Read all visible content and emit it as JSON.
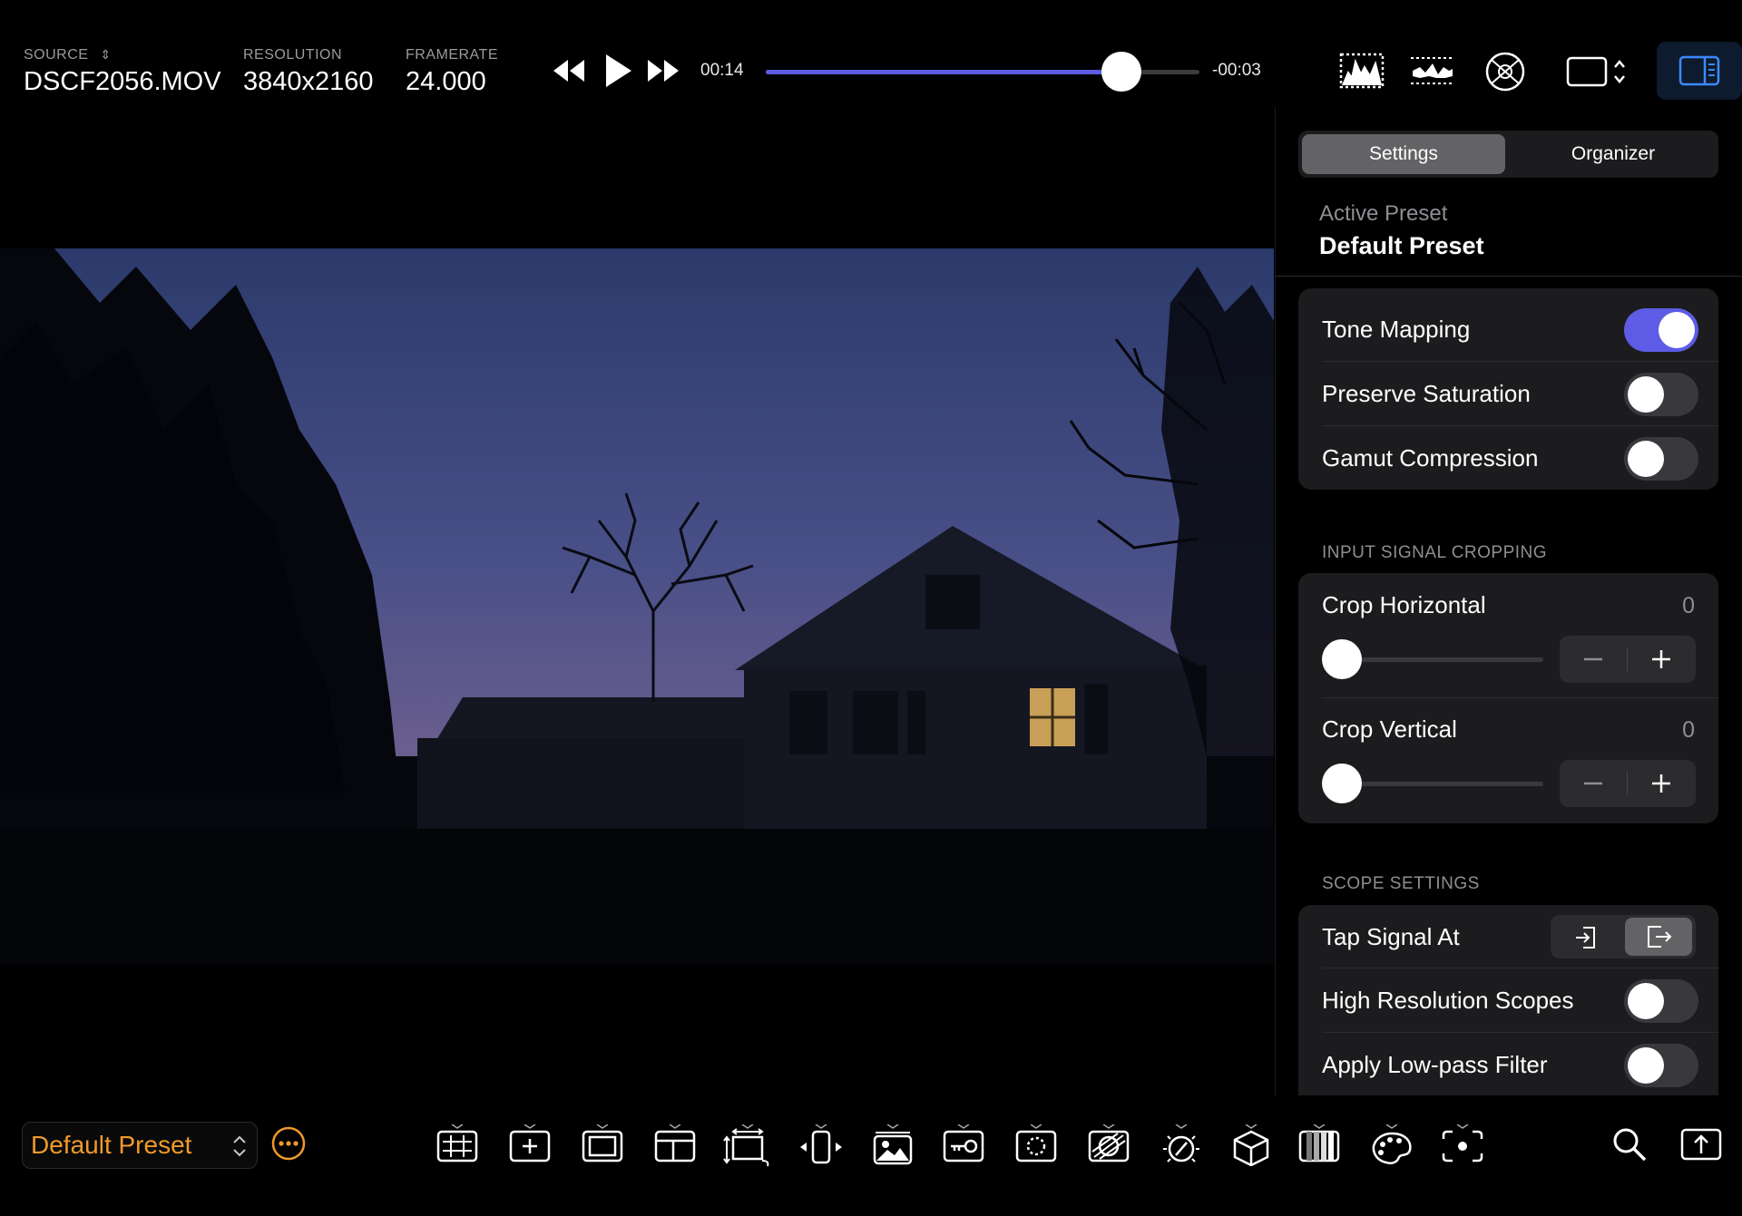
{
  "top_bar": {
    "source": {
      "label": "SOURCE",
      "value": "DSCF2056.MOV"
    },
    "resolution": {
      "label": "RESOLUTION",
      "value": "3840x2160"
    },
    "framerate": {
      "label": "FRAMERATE",
      "value": "24.000"
    },
    "elapsed": "00:14",
    "remaining": "-00:03",
    "progress": 0.82,
    "icons": [
      "rewind-icon",
      "play-icon",
      "fast-forward-icon",
      "histogram-icon",
      "waveform-icon",
      "vectorscope-icon",
      "aspect-ratio-icon",
      "sidebar-toggle-icon"
    ]
  },
  "sidebar": {
    "tabs": [
      {
        "label": "Settings",
        "selected": true
      },
      {
        "label": "Organizer",
        "selected": false
      }
    ],
    "active_preset_label": "Active Preset",
    "active_preset_name": "Default Preset",
    "tone_group": [
      {
        "label": "Tone Mapping",
        "on": true
      },
      {
        "label": "Preserve Saturation",
        "on": false
      },
      {
        "label": "Gamut Compression",
        "on": false
      }
    ],
    "cropping": {
      "header": "INPUT SIGNAL CROPPING",
      "horizontal": {
        "label": "Crop Horizontal",
        "value": "0"
      },
      "vertical": {
        "label": "Crop Vertical",
        "value": "0"
      }
    },
    "scope": {
      "header": "SCOPE SETTINGS",
      "tap_label": "Tap Signal At",
      "tap_selected": "output",
      "high_res": {
        "label": "High Resolution Scopes",
        "on": false
      },
      "low_pass": {
        "label": "Apply Low-pass Filter",
        "on": false
      }
    }
  },
  "bottom_bar": {
    "preset": "Default Preset",
    "tools": [
      "grid-overlay-icon",
      "center-marker-icon",
      "frame-guide-icon",
      "safe-area-icon",
      "scale-icon",
      "flip-icon",
      "image-overlay-icon",
      "lut-key-icon",
      "focus-peaking-icon",
      "false-color-icon",
      "exposure-icon",
      "cube-3d-icon",
      "zebra-icon",
      "color-palette-icon",
      "spot-meter-icon"
    ],
    "right_icons": [
      "search-icon",
      "export-icon"
    ]
  },
  "colors": {
    "accent": "#5e5ce6",
    "preset_orange": "#f09a2a",
    "panel": "#1c1c1e"
  }
}
